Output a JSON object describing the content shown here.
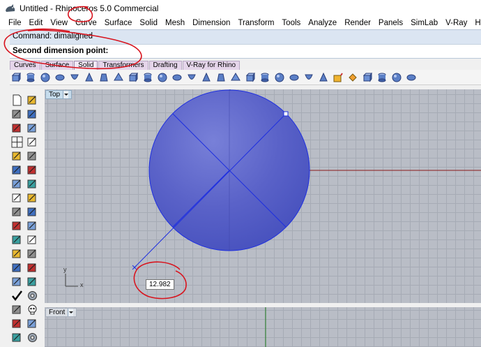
{
  "window": {
    "title": "Untitled - Rhinoceros 5.0 Commercial"
  },
  "menu": {
    "items": [
      "File",
      "Edit",
      "View",
      "Curve",
      "Surface",
      "Solid",
      "Mesh",
      "Dimension",
      "Transform",
      "Tools",
      "Analyze",
      "Render",
      "Panels",
      "SimLab",
      "V-Ray",
      "Help"
    ]
  },
  "command": {
    "history": "Command: dimaligned",
    "prompt": "Second dimension point:"
  },
  "toolbar_tabs": {
    "items": [
      "Curves",
      "Surface",
      "Solid",
      "Transformers",
      "Drafting",
      "V-Ray for Rhino"
    ],
    "active": "Solid"
  },
  "toolbar_icons": [
    "box-icon",
    "cylinder-icon",
    "sphere-icon",
    "ellipsoid-icon",
    "paraboloid-icon",
    "cone-icon",
    "truncated-cone-icon",
    "pyramid-icon",
    "tube-icon",
    "pipe-icon",
    "torus-icon",
    "extrude-icon",
    "extrude-curve-icon",
    "ribbon-icon",
    "slab-icon",
    "cap-icon",
    "boolean-icon",
    "boolean-union-icon",
    "boolean-difference-icon",
    "boolean-intersection-icon",
    "boolean-split-icon",
    "fillet-edge-icon",
    "chamfer-edge-icon",
    "solid-edit-icon",
    "move-face-icon",
    "extract-surface-icon",
    "merge-faces-icon",
    "solid-analysis-icon"
  ],
  "viewports": {
    "top": {
      "label": "Top"
    },
    "front": {
      "label": "Front"
    }
  },
  "dimension": {
    "value": "12.982"
  },
  "axes": {
    "x": "x",
    "y": "y"
  },
  "colors": {
    "sphere_fill": "#5a63c9",
    "selection_blue": "#1e2fe0",
    "x_axis_red": "#8b1a1a",
    "y_axis_green": "#1f7a1f",
    "annotation_red": "#d8141e",
    "grid_bg": "#b9bdc6"
  }
}
